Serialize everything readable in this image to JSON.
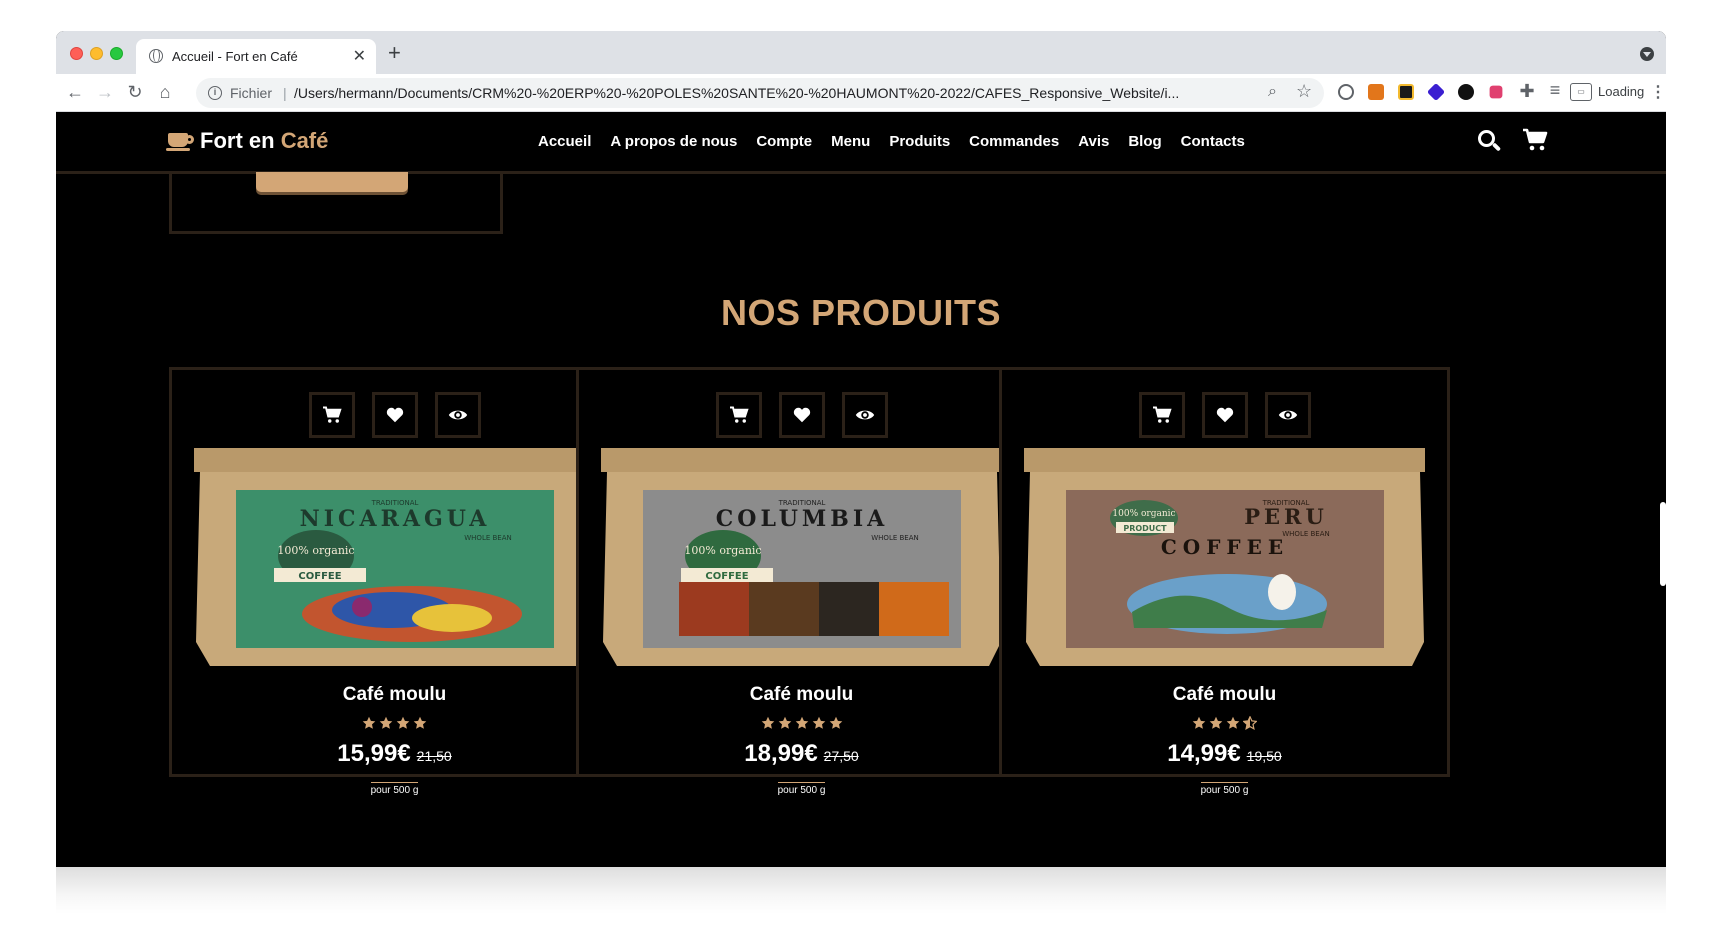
{
  "browser": {
    "tab_title": "Accueil - Fort en Café",
    "address_prefix": "Fichier",
    "url": "/Users/hermann/Documents/CRM%20-%20ERP%20-%20POLES%20SANTE%20-%20HAUMONT%20-2022/CAFES_Responsive_Website/i...",
    "extension_status": "Loading"
  },
  "site": {
    "logo_main": "Fort en",
    "logo_accent": "Café",
    "accent_color": "#d3a676",
    "nav": [
      "Accueil",
      "A propos de nous",
      "Compte",
      "Menu",
      "Produits",
      "Commandes",
      "Avis",
      "Blog",
      "Contacts"
    ]
  },
  "products_section": {
    "title": "NOS PRODUITS",
    "products": [
      {
        "name": "Café moulu",
        "rating": 4,
        "price": "15,99€",
        "old_price": "21,50",
        "weight": "pour 500 g",
        "bag": {
          "origin": "NICARAGUA",
          "tag": "TRADITIONAL",
          "sub": "WHOLE BEAN",
          "badge": "100% organic",
          "ribbon": "COFFEE",
          "label_color": "#3c8f6a"
        }
      },
      {
        "name": "Café moulu",
        "rating": 5,
        "price": "18,99€",
        "old_price": "27,50",
        "weight": "pour 500 g",
        "bag": {
          "origin": "COLUMBIA",
          "tag": "TRADITIONAL",
          "sub": "WHOLE BEAN",
          "badge": "100% organic",
          "ribbon": "COFFEE",
          "label_color": "#8c8c8c"
        }
      },
      {
        "name": "Café moulu",
        "rating": 3.5,
        "price": "14,99€",
        "old_price": "19,50",
        "weight": "pour 500 g",
        "bag": {
          "origin": "PERU",
          "tag": "TRADITIONAL",
          "sub": "WHOLE BEAN",
          "badge": "100% organic",
          "ribbon": "PRODUCT",
          "line2": "COFFEE",
          "label_color": "#8b6a5a"
        }
      }
    ]
  }
}
